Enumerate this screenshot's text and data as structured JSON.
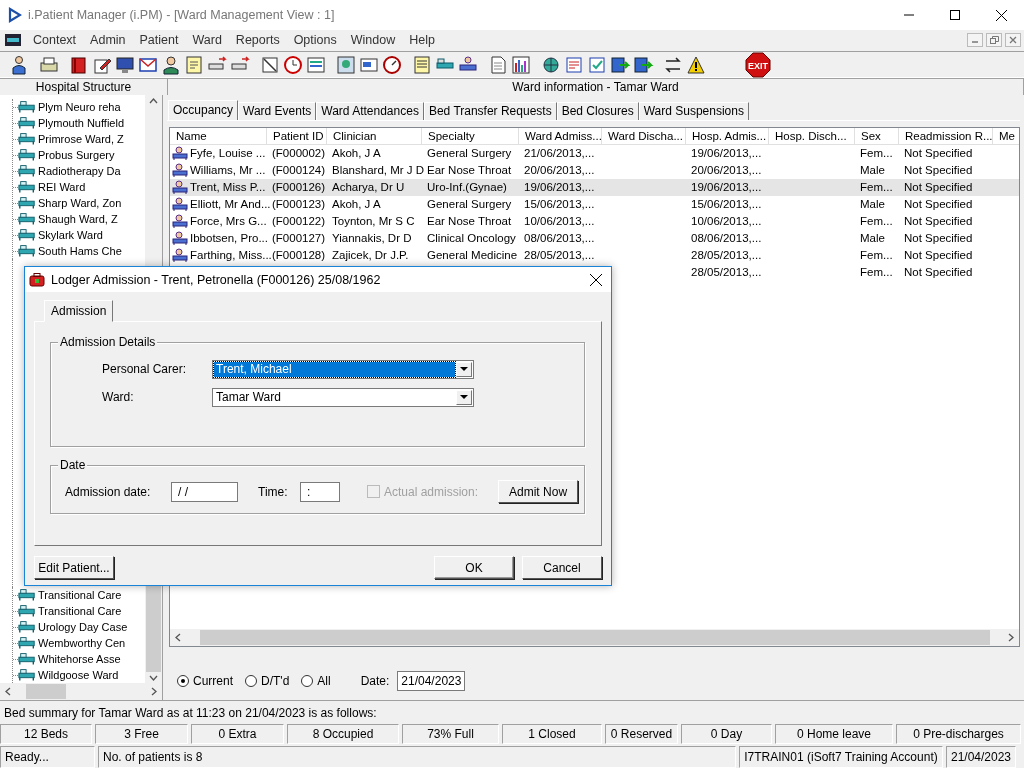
{
  "window": {
    "title": "i.Patient Manager (i.PM) - [Ward Management View : 1]"
  },
  "menu": [
    "Context",
    "Admin",
    "Patient",
    "Ward",
    "Reports",
    "Options",
    "Window",
    "Help"
  ],
  "toolbar": {
    "exit_label": "EXIT"
  },
  "tree": {
    "title": "Hospital Structure",
    "items": [
      "Plym Neuro reha",
      "Plymouth Nuffield",
      "Primrose Ward, Z",
      "Probus Surgery",
      "Radiotherapy Da",
      "REI Ward",
      "Sharp Ward, Zon",
      "Shaugh Ward, Z",
      "Skylark Ward",
      "South Hams Che"
    ],
    "lower_items": [
      "Transitional Care",
      "Transitional Care",
      "Urology Day Case",
      "Wembworthy Cen",
      "Whitehorse Asse",
      "Wildgoose Ward"
    ]
  },
  "ward_panel": {
    "title": "Ward information - Tamar Ward",
    "tabs": [
      {
        "label": "Occupancy",
        "selected": true
      },
      {
        "label": "Ward Events",
        "selected": false
      },
      {
        "label": "Ward Attendances",
        "selected": false
      },
      {
        "label": "Bed Transfer Requests",
        "selected": false
      },
      {
        "label": "Bed Closures",
        "selected": false
      },
      {
        "label": "Ward Suspensions",
        "selected": false
      }
    ],
    "columns": [
      "Name",
      "Patient ID",
      "Clinician",
      "Specialty",
      "Ward Admiss...",
      "Ward Discha...",
      "Hosp. Admis...",
      "Hosp. Disch...",
      "Sex",
      "Readmission R...",
      "Me"
    ],
    "rows": [
      {
        "name": "Fyfe, Louise ...",
        "patient_id": "(F000002)",
        "clinician": "Akoh, J A",
        "specialty": "General Surgery",
        "ward_admission": "21/06/2013,...",
        "hosp_admission": "19/06/2013,...",
        "sex": "Fem...",
        "readmission": "Not Specified",
        "selected": false
      },
      {
        "name": "Williams, Mr ...",
        "patient_id": "(F000124)",
        "clinician": "Blanshard, Mr J D",
        "specialty": "Ear Nose Throat",
        "ward_admission": "20/06/2013,...",
        "hosp_admission": "20/06/2013,...",
        "sex": "Male",
        "readmission": "Not Specified",
        "selected": false
      },
      {
        "name": "Trent, Miss P...",
        "patient_id": "(F000126)",
        "clinician": "Acharya, Dr U",
        "specialty": "Uro-Inf.(Gynae)",
        "ward_admission": "19/06/2013,...",
        "hosp_admission": "19/06/2013,...",
        "sex": "Fem...",
        "readmission": "Not Specified",
        "selected": true
      },
      {
        "name": "Elliott, Mr And...",
        "patient_id": "(F000123)",
        "clinician": "Akoh, J A",
        "specialty": "General Surgery",
        "ward_admission": "15/06/2013,...",
        "hosp_admission": "15/06/2013,...",
        "sex": "Male",
        "readmission": "Not Specified",
        "selected": false
      },
      {
        "name": "Force, Mrs G...",
        "patient_id": "(F000122)",
        "clinician": "Toynton, Mr S C",
        "specialty": "Ear Nose Throat",
        "ward_admission": "10/06/2013,...",
        "hosp_admission": "10/06/2013,...",
        "sex": "Fem...",
        "readmission": "Not Specified",
        "selected": false
      },
      {
        "name": "Ibbotsen, Pro...",
        "patient_id": "(F000127)",
        "clinician": "Yiannakis, Dr D",
        "specialty": "Clinical Oncology",
        "ward_admission": "08/06/2013,...",
        "hosp_admission": "08/06/2013,...",
        "sex": "Male",
        "readmission": "Not Specified",
        "selected": false
      },
      {
        "name": "Farthing, Miss...",
        "patient_id": "(F000128)",
        "clinician": "Zajicek, Dr J.P.",
        "specialty": "General Medicine",
        "ward_admission": "28/05/2013,...",
        "hosp_admission": "28/05/2013,...",
        "sex": "Fem...",
        "readmission": "Not Specified",
        "selected": false
      },
      {
        "hosp_admission": "28/05/2013,...",
        "sex": "Fem...",
        "readmission": "Not Specified",
        "selected": false
      }
    ],
    "filters": [
      {
        "label": "Current",
        "selected": true
      },
      {
        "label": "D/T'd",
        "selected": false
      },
      {
        "label": "All",
        "selected": false
      }
    ],
    "date_label": "Date:",
    "date": "21/04/2023"
  },
  "summary": {
    "text": "Bed summary for Tamar Ward as at 11:23 on 21/04/2023 is as follows:",
    "cells": [
      "12 Beds",
      "3 Free",
      "0 Extra",
      "8 Occupied",
      "73% Full",
      "1 Closed",
      "0 Reserved",
      "0 Day",
      "0 Home leave",
      "0 Pre-discharges"
    ]
  },
  "status_bar": [
    "Ready...",
    "No. of patients is 8",
    "I7TRAIN01 (iSoft7 Training Account)",
    "21/04/2023"
  ],
  "dialog": {
    "title": "Lodger Admission - Trent, Petronella (F000126) 25/08/1962",
    "tab": "Admission",
    "details_group": "Admission Details",
    "personal_carer_label": "Personal Carer:",
    "personal_carer": "Trent, Michael",
    "ward_label": "Ward:",
    "ward": "Tamar Ward",
    "date_group": "Date",
    "admission_date_label": "Admission date:",
    "admission_date": "/ /",
    "time_label": "Time:",
    "time": ":",
    "actual_admission": {
      "label": "Actual admission:",
      "checked": false,
      "disabled": true
    },
    "buttons": {
      "admit_now": "Admit Now",
      "edit_patient": "Edit Patient...",
      "ok": "OK",
      "cancel": "Cancel"
    }
  }
}
